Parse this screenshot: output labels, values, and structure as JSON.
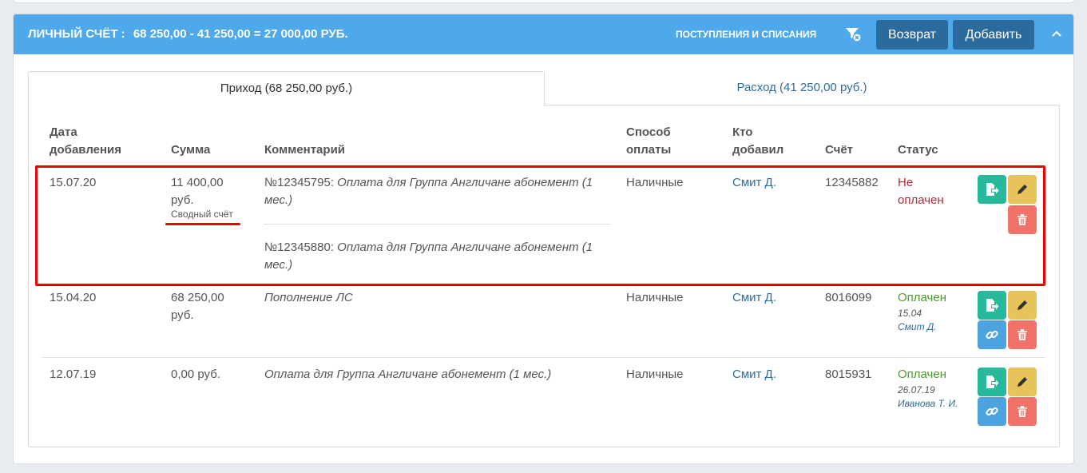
{
  "account": {
    "title_label": "Личный счёт :",
    "title_value": "68 250,00 - 41 250,00 = 27 000,00 руб."
  },
  "header": {
    "link_label": "Поступления и списания",
    "return_label": "Возврат",
    "add_label": "Добавить"
  },
  "tabs": [
    {
      "label": "Приход (68 250,00 руб.)",
      "active": true
    },
    {
      "label": "Расход (41 250,00 руб.)",
      "active": false
    }
  ],
  "columns": {
    "date": [
      "Дата",
      "добавления"
    ],
    "sum": "Сумма",
    "comment": "Комментарий",
    "payment": [
      "Способ",
      "оплаты"
    ],
    "who": [
      "Кто",
      "добавил"
    ],
    "invoice": "Счёт",
    "status": "Статус"
  },
  "rows": [
    {
      "date": "15.07.20",
      "sum": [
        "11 400,00",
        "руб."
      ],
      "sum_note": "Сводный счёт",
      "comments": [
        {
          "number": "№12345795:",
          "text": [
            "Оплата для Группа Англичане абонемент (1",
            "мес.)"
          ]
        },
        {
          "number": "№12345880:",
          "text": [
            "Оплата для Группа Англичане абонемент (1",
            "мес.)"
          ]
        }
      ],
      "payment": "Наличные",
      "who": "Смит Д.",
      "invoice": "12345882",
      "status": [
        "Не",
        "оплачен"
      ]
    },
    {
      "date": "15.04.20",
      "sum": [
        "68 250,00",
        "руб."
      ],
      "comment": "Пополнение ЛС",
      "payment": "Наличные",
      "who": "Смит Д.",
      "invoice": "8016099",
      "status": "Оплачен",
      "status_date": "15.04",
      "status_by": "Смит Д."
    },
    {
      "date": "12.07.19",
      "sum": "0,00 руб.",
      "comment": "Оплата для Группа Англичане абонемент (1 мес.)",
      "payment": "Наличные",
      "who": "Смит Д.",
      "invoice": "8015931",
      "status": "Оплачен",
      "status_date": "26.07.19",
      "status_by": "Иванова Т. И."
    }
  ],
  "icons": {
    "filter": "filter-reset-icon",
    "collapse": "chevron-up-icon",
    "issue": "document-export-icon",
    "edit": "pencil-icon",
    "delete": "trash-icon",
    "link": "chain-link-icon"
  },
  "colors": {
    "header": "#4ea8e9",
    "header_button": "#2b6a9c",
    "link": "#2d6b9f",
    "unpaid": "#b02a37",
    "paid": "#4e9a2a",
    "annotation": "#ee0000"
  }
}
